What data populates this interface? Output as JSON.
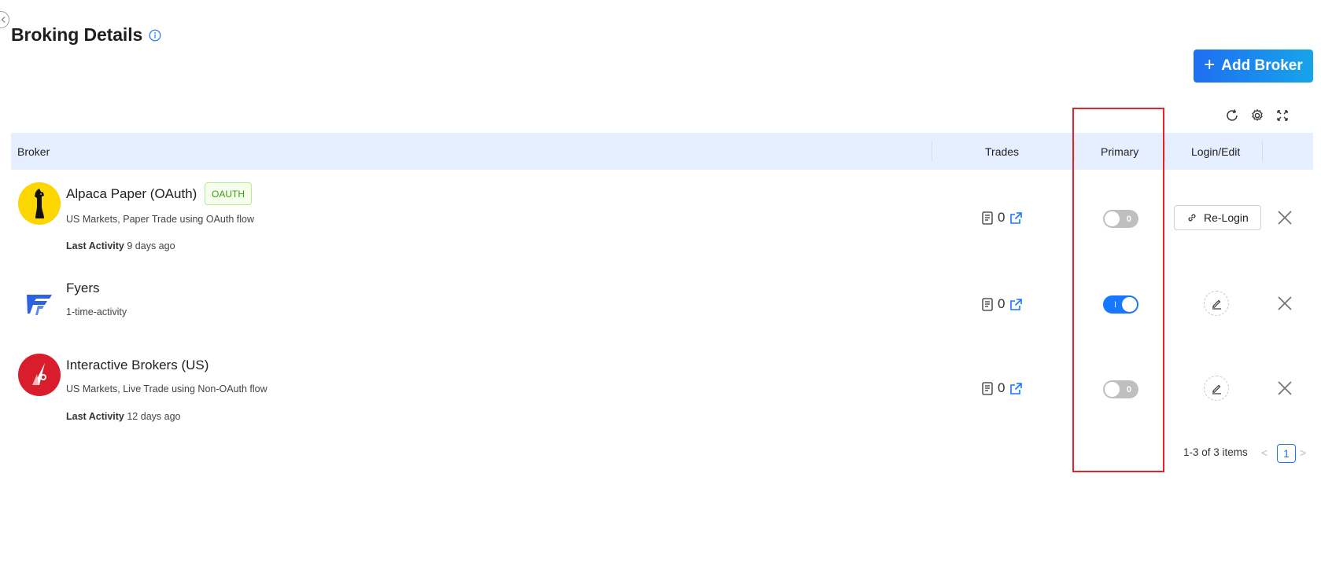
{
  "page": {
    "title": "Broking Details",
    "add_broker_label": "Add Broker"
  },
  "table": {
    "columns": {
      "broker": "Broker",
      "trades": "Trades",
      "primary": "Primary",
      "login_edit": "Login/Edit"
    },
    "rows": [
      {
        "name": "Alpaca Paper (OAuth)",
        "tag": "OAUTH",
        "description": "US Markets, Paper Trade using OAuth flow",
        "last_activity_label": "Last Activity",
        "last_activity_value": "9 days ago",
        "trades": "0",
        "primary": false,
        "primary_label": "0",
        "action_label": "Re-Login",
        "logo": "alpaca-logo"
      },
      {
        "name": "Fyers",
        "description": "1-time-activity",
        "trades": "0",
        "primary": true,
        "primary_label": "I",
        "action": "edit",
        "logo": "fyers-logo"
      },
      {
        "name": "Interactive Brokers (US)",
        "description": "US Markets, Live Trade using Non-OAuth flow",
        "last_activity_label": "Last Activity",
        "last_activity_value": "12 days ago",
        "trades": "0",
        "primary": false,
        "primary_label": "0",
        "action": "edit",
        "logo": "ibkr-logo"
      }
    ]
  },
  "pagination": {
    "summary": "1-3 of 3 items",
    "current_page": "1",
    "prev": "<",
    "next": ">"
  },
  "colors": {
    "accent": "#1677ff",
    "header_bg": "#e6efff",
    "highlight": "#e2232a",
    "oauth_tag": "#389e0d"
  }
}
